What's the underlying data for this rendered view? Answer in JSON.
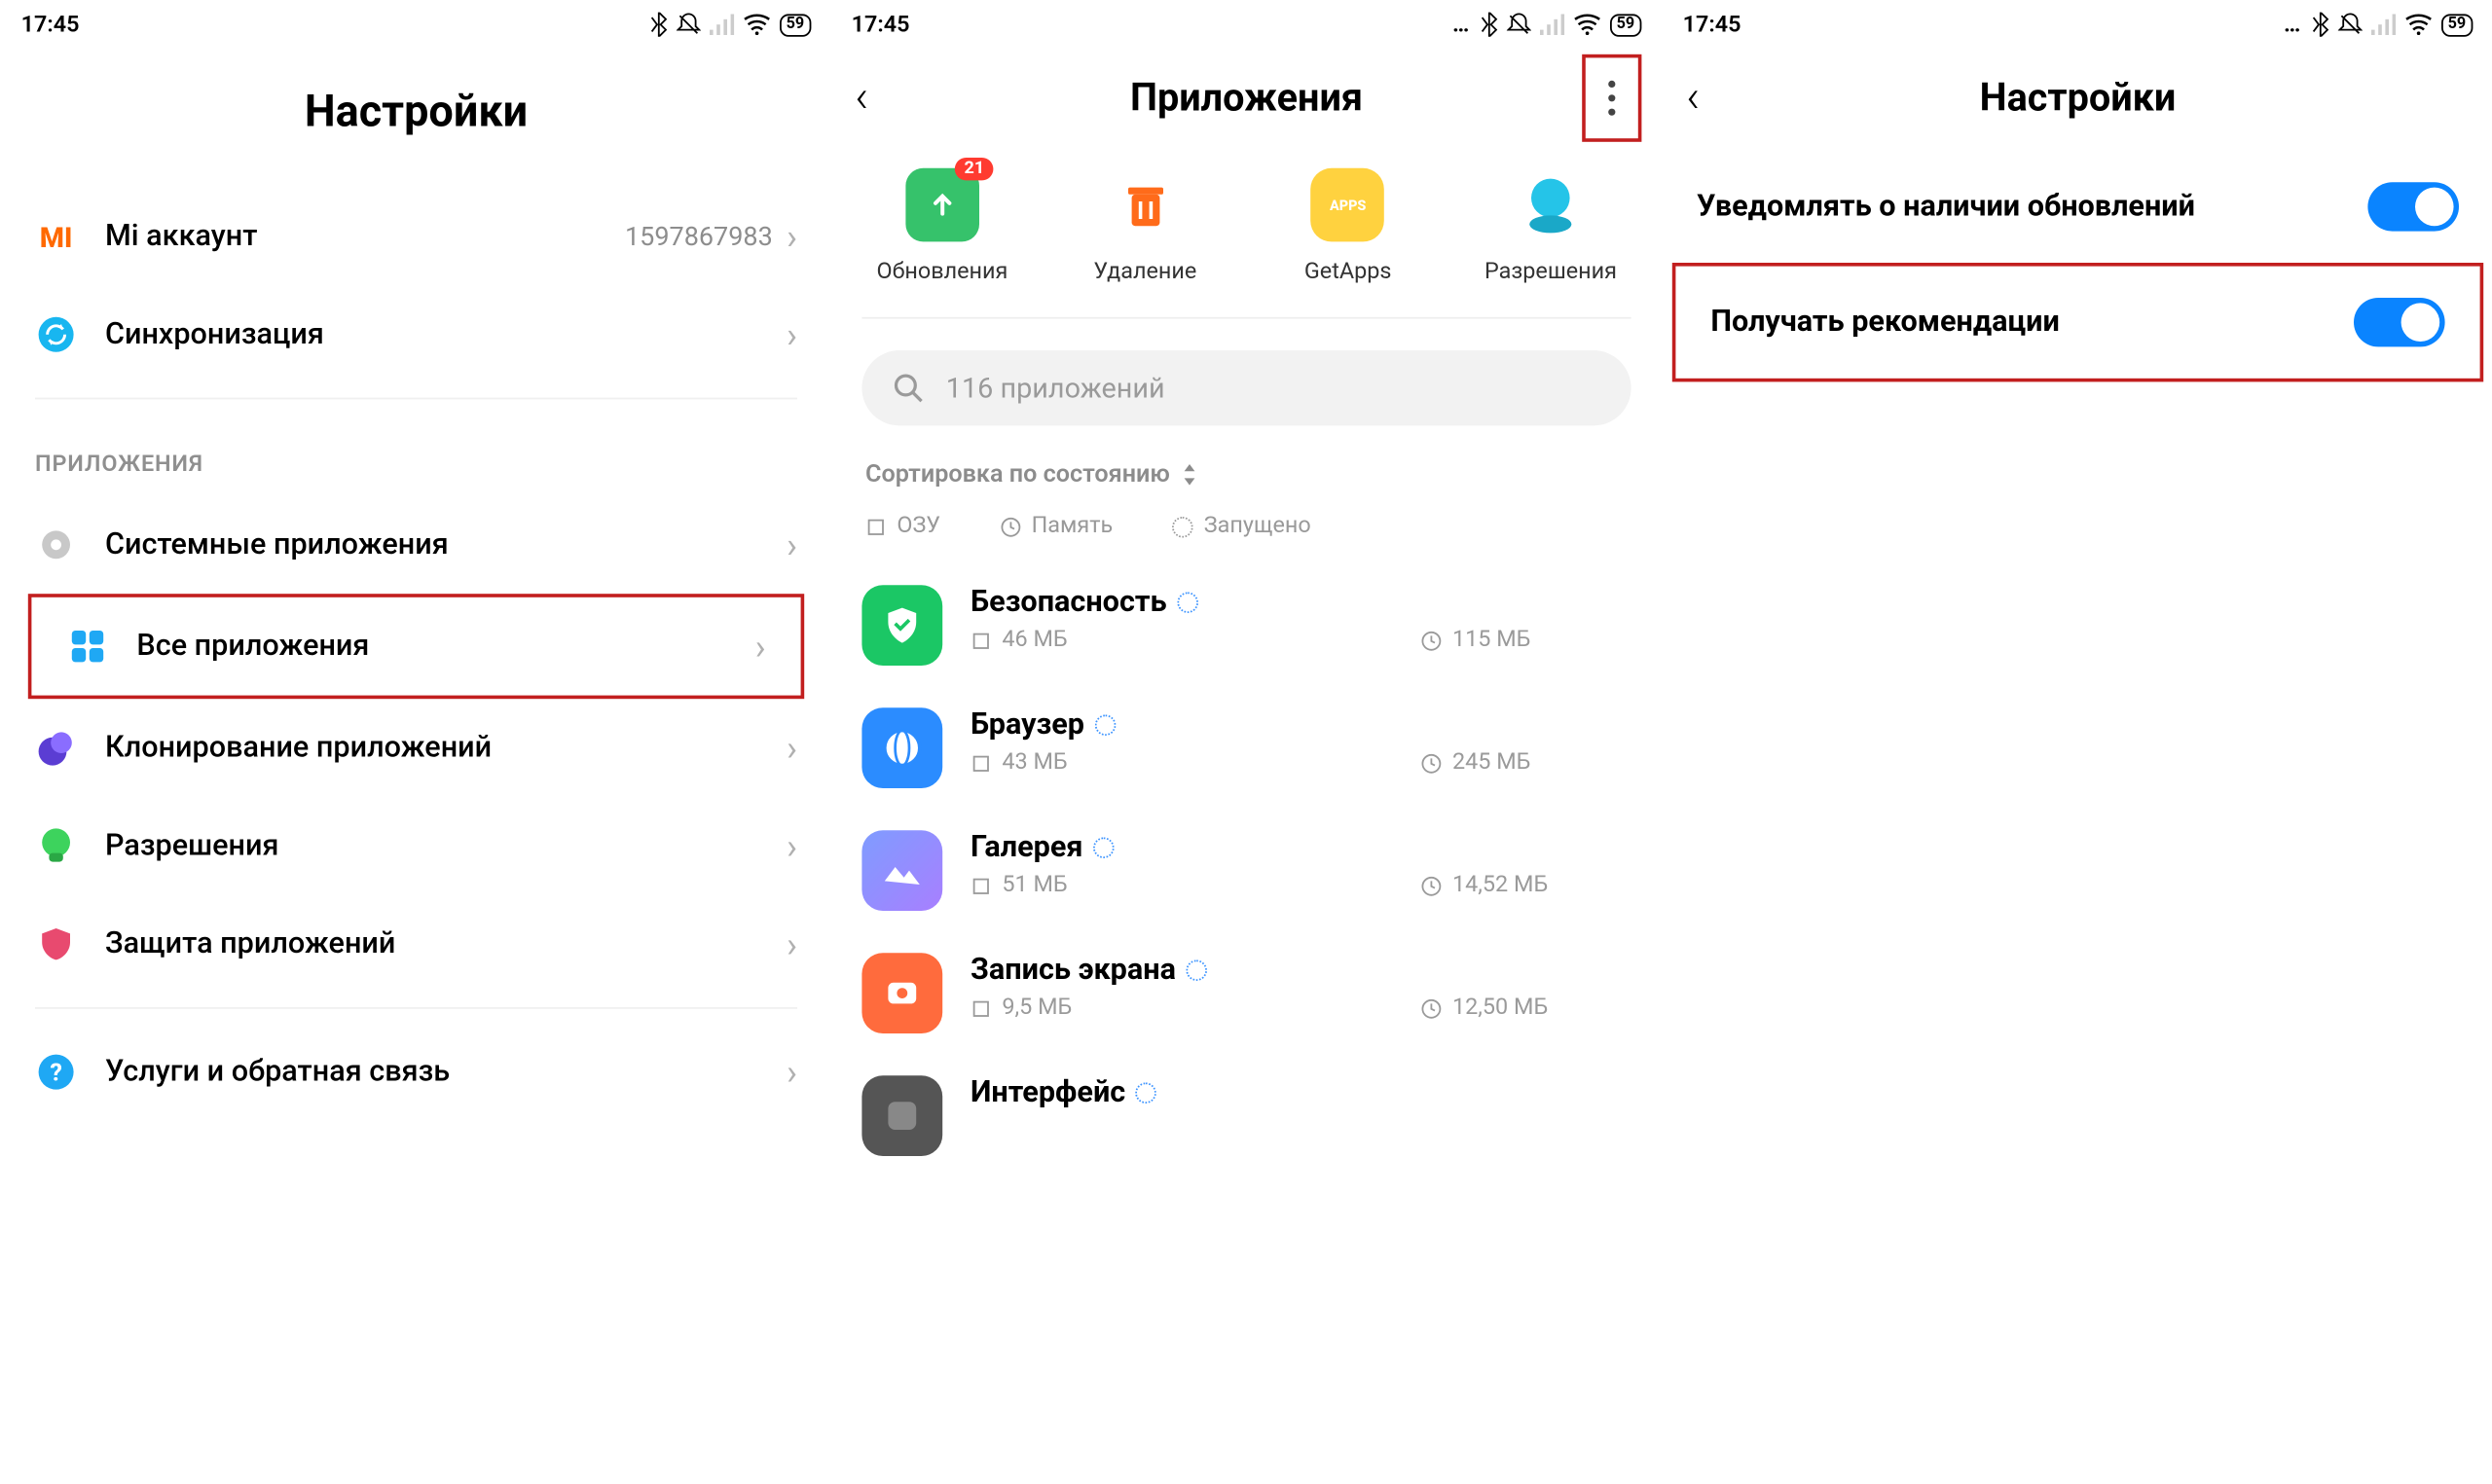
{
  "status": {
    "time": "17:45",
    "battery": "59"
  },
  "screen1": {
    "title": "Настройки",
    "account": {
      "label": "Mi аккаунт",
      "id": "1597867983"
    },
    "sync": "Синхронизация",
    "section": "ПРИЛОЖЕНИЯ",
    "items": {
      "system": "Системные приложения",
      "all": "Все приложения",
      "clone": "Клонирование приложений",
      "perm": "Разрешения",
      "protect": "Защита приложений",
      "support": "Услуги и обратная связь"
    }
  },
  "screen2": {
    "title": "Приложения",
    "quick": {
      "updates": "Обновления",
      "updates_badge": "21",
      "delete": "Удаление",
      "getapps": "GetApps",
      "perm": "Разрешения"
    },
    "search_placeholder": "116 приложений",
    "sort": "Сортировка по состоянию",
    "filters": {
      "ram": "ОЗУ",
      "mem": "Память",
      "run": "Запущено"
    },
    "apps": [
      {
        "name": "Безопасность",
        "ram": "46 МБ",
        "mem": "115 МБ"
      },
      {
        "name": "Браузер",
        "ram": "43 МБ",
        "mem": "245 МБ"
      },
      {
        "name": "Галерея",
        "ram": "51 МБ",
        "mem": "14,52 МБ"
      },
      {
        "name": "Запись экрана",
        "ram": "9,5 МБ",
        "mem": "12,50 МБ"
      },
      {
        "name": "Интерфейс",
        "ram": "",
        "mem": ""
      }
    ]
  },
  "screen3": {
    "title": "Настройки",
    "notify_updates": "Уведомлять о наличии обновлений",
    "recommendations": "Получать рекомендации"
  }
}
